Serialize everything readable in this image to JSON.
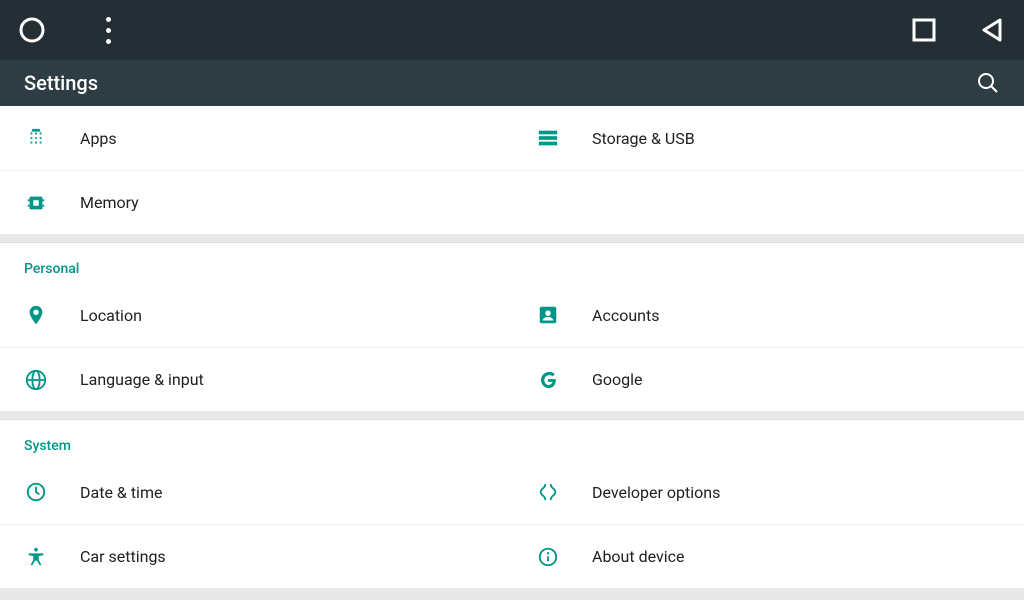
{
  "appbar": {
    "title": "Settings"
  },
  "sections": {
    "device_tail": {
      "items": {
        "apps": "Apps",
        "storage": "Storage & USB",
        "memory": "Memory"
      }
    },
    "personal": {
      "header": "Personal",
      "items": {
        "location": "Location",
        "accounts": "Accounts",
        "language": "Language & input",
        "google": "Google"
      }
    },
    "system": {
      "header": "System",
      "items": {
        "datetime": "Date & time",
        "developer": "Developer options",
        "car": "Car settings",
        "about": "About device"
      }
    }
  },
  "colors": {
    "accent": "#009688",
    "navbar": "#232f34",
    "appbar": "#2e3d44"
  }
}
